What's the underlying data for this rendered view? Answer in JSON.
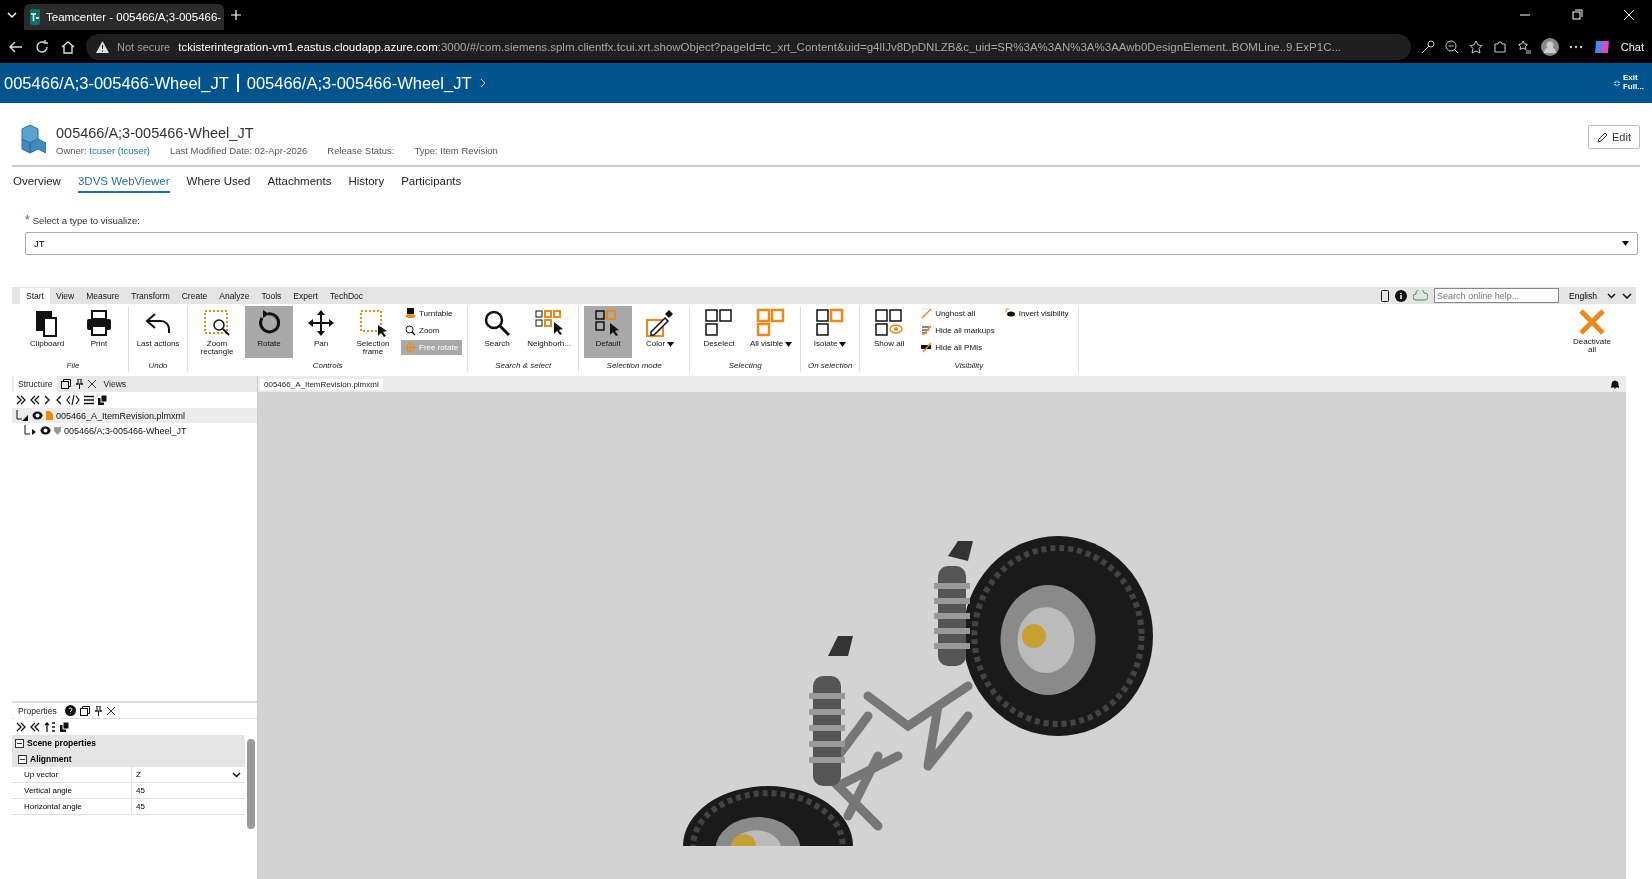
{
  "browser": {
    "tab_title": "Teamcenter - 005466/A;3-005466-",
    "security": "Not secure",
    "url_host": "tckisterintegration-vm1.eastus.cloudapp.azure.com",
    "url_rest": ":3000/#/com.siemens.splm.clientfx.tcui.xrt.showObject?pageId=tc_xrt_Content&uid=g4lIJv8DpDNLZB&c_uid=SR%3A%3AN%3A%3AAwb0DesignElement..BOMLine..9.ExP1C...",
    "chat": "Chat"
  },
  "header": {
    "breadcrumbs": [
      "005466/A;3-005466-Wheel_JT",
      "005466/A;3-005466-Wheel_JT"
    ],
    "exit_label": "Exit Full..."
  },
  "item": {
    "title": "005466/A;3-005466-Wheel_JT",
    "owner_label": "Owner:",
    "owner": "tcuser (tcuser)",
    "modified_label": "Last Modified Date:",
    "modified": "02-Apr-2026",
    "release_label": "Release Status:",
    "type_label": "Type:",
    "type": "Item Revision",
    "edit_button": "Edit"
  },
  "tabs": [
    {
      "label": "Overview",
      "selected": false
    },
    {
      "label": "3DVS WebViewer",
      "selected": true
    },
    {
      "label": "Where Used",
      "selected": false
    },
    {
      "label": "Attachments",
      "selected": false
    },
    {
      "label": "History",
      "selected": false
    },
    {
      "label": "Participants",
      "selected": false
    }
  ],
  "visualize": {
    "required_mark": "*",
    "label": "Select a type to visualize:",
    "value": "JT"
  },
  "ribbon": {
    "tabs": [
      {
        "label": "Start",
        "selected": true
      },
      {
        "label": "View",
        "selected": false
      },
      {
        "label": "Measure",
        "selected": false
      },
      {
        "label": "Transform",
        "selected": false
      },
      {
        "label": "Create",
        "selected": false
      },
      {
        "label": "Analyze",
        "selected": false
      },
      {
        "label": "Tools",
        "selected": false
      },
      {
        "label": "Expert",
        "selected": false
      },
      {
        "label": "TechDoc",
        "selected": false
      }
    ],
    "search_placeholder": "Search online help...",
    "language": "English",
    "groups": [
      {
        "label": "File",
        "items": [
          {
            "kind": "large",
            "label": "Clipboard",
            "selected": false
          },
          {
            "kind": "large",
            "label": "Print",
            "selected": false
          }
        ]
      },
      {
        "label": "Undo",
        "items": [
          {
            "kind": "large",
            "label": "Last actions",
            "selected": false
          }
        ]
      },
      {
        "label": "Controls",
        "items": [
          {
            "kind": "large",
            "label": "Zoom rectangle",
            "selected": false
          },
          {
            "kind": "large",
            "label": "Rotate",
            "selected": true
          },
          {
            "kind": "large",
            "label": "Pan",
            "selected": false
          },
          {
            "kind": "large",
            "label": "Selection frame",
            "selected": false
          },
          {
            "kind": "small",
            "label": "Turntable",
            "selected": false
          },
          {
            "kind": "small",
            "label": "Zoom",
            "selected": false
          },
          {
            "kind": "small",
            "label": "Free rotate",
            "selected": true
          }
        ]
      },
      {
        "label": "Search & select",
        "items": [
          {
            "kind": "large",
            "label": "Search",
            "selected": false
          },
          {
            "kind": "large",
            "label": "Neighborh...",
            "selected": false
          }
        ]
      },
      {
        "label": "Selection mode",
        "items": [
          {
            "kind": "large",
            "label": "Default",
            "selected": true
          },
          {
            "kind": "large",
            "label": "Color",
            "selected": false,
            "dropdown": true
          }
        ]
      },
      {
        "label": "Selecting",
        "items": [
          {
            "kind": "large",
            "label": "Deselect",
            "selected": false
          },
          {
            "kind": "large",
            "label": "All visible",
            "selected": false,
            "dropdown": true
          }
        ]
      },
      {
        "label": "On selection",
        "items": [
          {
            "kind": "large",
            "label": "Isolate",
            "selected": false,
            "dropdown": true
          }
        ]
      },
      {
        "label": "Visibility",
        "items": [
          {
            "kind": "large",
            "label": "Show all",
            "selected": false
          },
          {
            "kind": "small",
            "label": "Unghost all",
            "selected": false
          },
          {
            "kind": "small",
            "label": "Hide all markups",
            "selected": false
          },
          {
            "kind": "small",
            "label": "Hide all PMIs",
            "selected": false
          },
          {
            "kind": "small",
            "label": "Invert visibility",
            "selected": false
          }
        ]
      }
    ],
    "deactivate": "Deactivate all"
  },
  "structure": {
    "tabs": [
      {
        "label": "Structure",
        "selected": true
      },
      {
        "label": "Views",
        "selected": false
      }
    ],
    "tree": [
      {
        "label": "005466_A_ItemRevision.plmxml",
        "expanded": true,
        "selected": true,
        "children": [
          {
            "label": "005466/A;3-005466-Wheel_JT",
            "expanded": false,
            "selected": false
          }
        ]
      }
    ]
  },
  "viewer": {
    "tab": "005466_A_ItemRevision.plmxml"
  },
  "properties": {
    "title": "Properties",
    "sections": [
      {
        "label": "Scene properties",
        "expanded": true,
        "children": [
          {
            "label": "Alignment",
            "expanded": true,
            "rows": [
              {
                "kind": "dropdown",
                "name": "Up vector",
                "value": "Z"
              },
              {
                "kind": "text",
                "name": "Vertical angle",
                "value": "45"
              },
              {
                "kind": "text",
                "name": "Horizontal angle",
                "value": "45"
              }
            ]
          }
        ]
      }
    ]
  }
}
